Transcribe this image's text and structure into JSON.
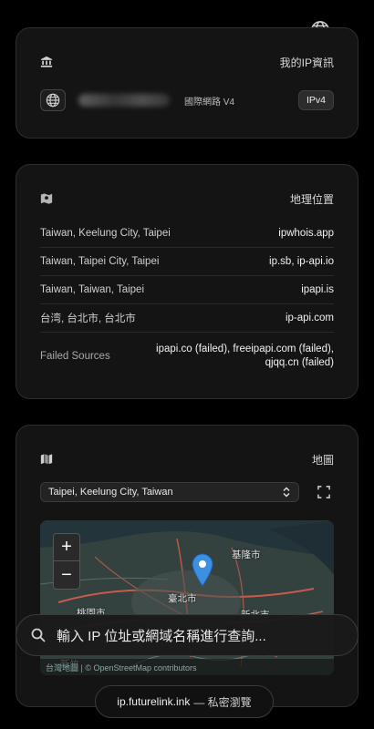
{
  "top_icon": "globe-icon",
  "ip_card": {
    "title": "我的IP資訊",
    "icon": "bank-icon",
    "network": "國際網路 V4",
    "badge": "IPv4"
  },
  "geo_card": {
    "title": "地理位置",
    "icon": "map-marker-icon",
    "rows": [
      {
        "left": "Taiwan, Keelung City, Taipei",
        "right": "ipwhois.app"
      },
      {
        "left": "Taiwan, Taipei City, Taipei",
        "right": "ip.sb, ip-api.io"
      },
      {
        "left": "Taiwan, Taiwan, Taipei",
        "right": "ipapi.is"
      },
      {
        "left": "台湾, 台北市, 台北市",
        "right": "ip-api.com"
      },
      {
        "left": "Failed Sources",
        "right": "ipapi.co (failed), freeipapi.com (failed), qjqq.cn (failed)"
      }
    ]
  },
  "map_card": {
    "title": "地圖",
    "icon": "map-icon",
    "select_value": "Taipei, Keelung City, Taiwan",
    "zoom_in": "+",
    "zoom_out": "−",
    "labels": {
      "keelung": "基隆市",
      "taipei": "臺北市",
      "new_taipei": "新北市",
      "taoyuan": "桃園市",
      "hsinchu": "新竹"
    },
    "attribution": "台灣地圖 | © OpenStreetMap contributors"
  },
  "search": {
    "placeholder": "輸入 IP 位址或網域名稱進行查詢..."
  },
  "footer": {
    "site": "ip.futurelink.ink",
    "tagline": "— 私密瀏覽"
  }
}
